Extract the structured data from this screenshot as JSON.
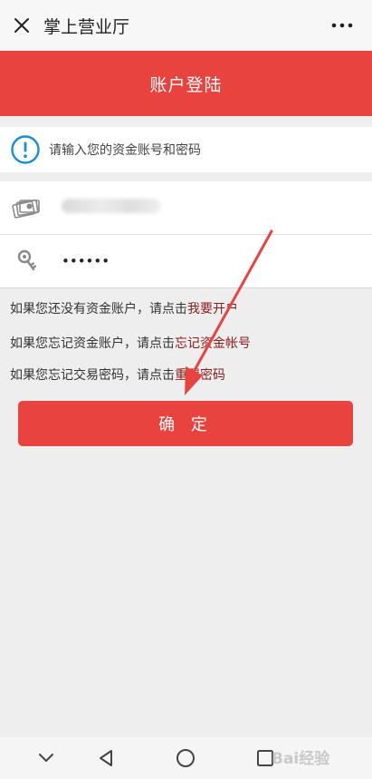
{
  "topbar": {
    "title": "掌上营业厅",
    "close_icon": "close-icon",
    "more_icon": "more-dots-icon"
  },
  "header": {
    "title": "账户登陆"
  },
  "info": {
    "text": "请输入您的资金账号和密码",
    "icon": "info-circle-icon",
    "icon_color": "#1a8cd8"
  },
  "account": {
    "icon": "money-icon",
    "value_hidden": true
  },
  "password": {
    "icon": "key-icon",
    "value": "••••••"
  },
  "hints": [
    {
      "prefix": "如果您还没有资金账户，请点击",
      "link": "我要开户"
    },
    {
      "prefix": "如果您忘记资金账户，请点击",
      "link": "忘记资金帐号"
    },
    {
      "prefix": "如果您忘记交易密码，请点击",
      "link": "重置密码"
    }
  ],
  "confirm_label": "确 定",
  "colors": {
    "accent": "#e8433f",
    "link": "#8b1c1c",
    "annotation_arrow": "#e8433f"
  },
  "navbar": {
    "icons": [
      "chevron-down-icon",
      "back-triangle-icon",
      "home-circle-icon",
      "recent-square-icon"
    ]
  },
  "watermark": {
    "text": "Bai经验"
  }
}
